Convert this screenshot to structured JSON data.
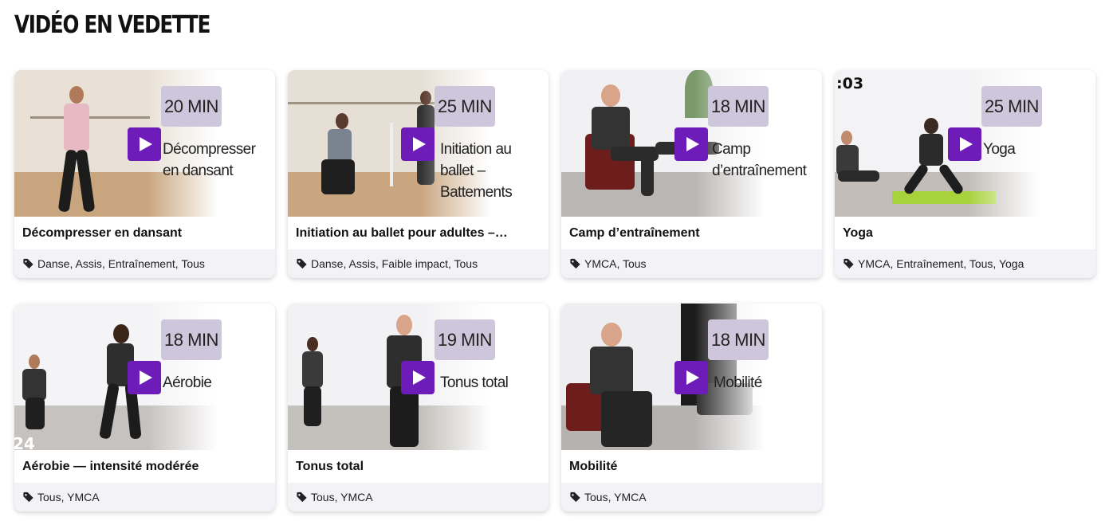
{
  "page": {
    "title": "VIDÉO EN VEDETTE"
  },
  "colors": {
    "play_button": "#6d1cb9",
    "duration_badge": "#cec6da",
    "tags_bg": "#f3f2f7"
  },
  "videos": [
    {
      "duration": "20 MIN",
      "thumb_caption": "Décompresser en dansant",
      "title": "Décompresser en dansant",
      "tags": [
        "Danse",
        "Assis",
        "Entraînement",
        "Tous"
      ]
    },
    {
      "duration": "25 MIN",
      "thumb_caption": "Initiation au ballet – Battements",
      "title": "Initiation au ballet pour adultes –…",
      "tags": [
        "Danse",
        "Assis",
        "Faible impact",
        "Tous"
      ]
    },
    {
      "duration": "18 MIN",
      "thumb_caption": "Camp d’entraînement",
      "title": "Camp d’entraînement",
      "tags": [
        "YMCA",
        "Tous"
      ]
    },
    {
      "duration": "25 MIN",
      "thumb_caption": "Yoga",
      "title": "Yoga",
      "tags": [
        "YMCA",
        "Entraînement",
        "Tous",
        "Yoga"
      ],
      "overlay": ":03"
    },
    {
      "duration": "18 MIN",
      "thumb_caption": "Aérobie",
      "title": "Aérobie — intensité modérée",
      "tags": [
        "Tous",
        "YMCA"
      ],
      "overlay": "24"
    },
    {
      "duration": "19 MIN",
      "thumb_caption": "Tonus total",
      "title": "Tonus total",
      "tags": [
        "Tous",
        "YMCA"
      ]
    },
    {
      "duration": "18 MIN",
      "thumb_caption": "Mobilité",
      "title": "Mobilité",
      "tags": [
        "Tous",
        "YMCA"
      ]
    }
  ],
  "icons": {
    "tag": "tag-icon",
    "play": "play-icon"
  }
}
